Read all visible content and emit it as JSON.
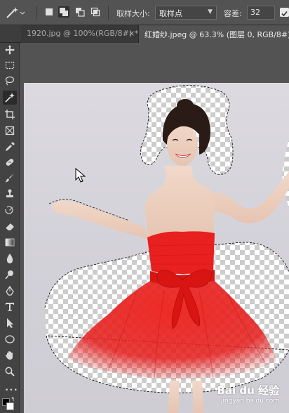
{
  "options_bar": {
    "sample_size_label": "取样大小:",
    "sample_size_value": "取样点",
    "tolerance_label": "容差:",
    "tolerance_value": "32",
    "anti_alias_checked": true
  },
  "tabs": [
    {
      "label": "1920.jpg @ 100%(RGB/8#) *",
      "active": false
    },
    {
      "label": "红婚纱.jpeg @ 63.3% (图层 0, RGB/8#) *",
      "active": true
    }
  ],
  "toolbar": {
    "active_tool": "magic-wand-icon",
    "tools": [
      "move-icon",
      "marquee-icon",
      "lasso-icon",
      "magic-wand-icon",
      "crop-icon",
      "frame-icon",
      "eyedropper-icon",
      "healing-brush-icon",
      "brush-icon",
      "clone-stamp-icon",
      "history-brush-icon",
      "eraser-icon",
      "gradient-icon",
      "blur-icon",
      "dodge-icon",
      "pen-icon",
      "type-icon",
      "path-select-icon",
      "ellipse-icon",
      "hand-icon",
      "zoom-icon"
    ],
    "more_label": "•••"
  },
  "watermark": {
    "logo": "Bai du 经验",
    "url": "jingyan.baidu.com"
  },
  "colors": {
    "dress_red": "#e8201f",
    "background_photo": "#d6d4db",
    "ui_dark": "#535353"
  }
}
